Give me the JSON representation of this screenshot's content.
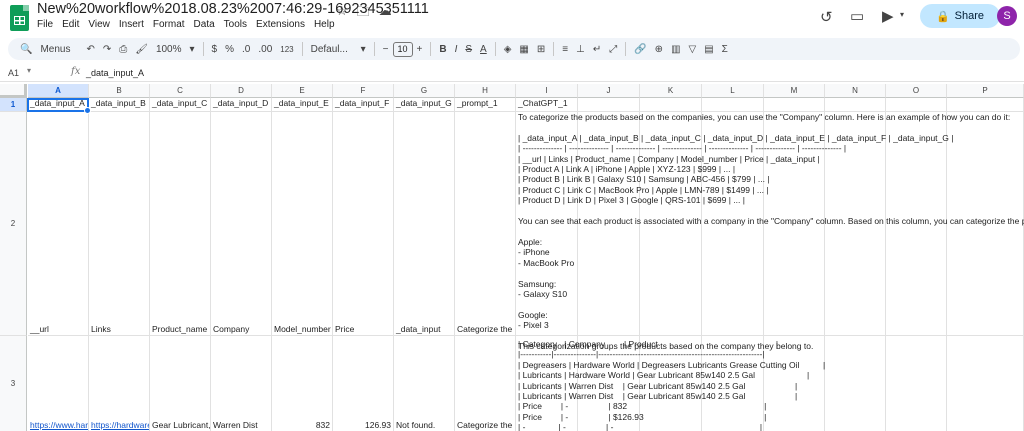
{
  "app": {
    "doc_title": "New%20workflow%2018.08.23%2007:46:29-1692345351111",
    "menus": [
      "File",
      "Edit",
      "View",
      "Insert",
      "Format",
      "Data",
      "Tools",
      "Extensions",
      "Help"
    ],
    "share_label": "Share",
    "avatar_letter": "S"
  },
  "toolbar": {
    "menus_label": "Menus",
    "zoom": "100%",
    "currency": "$",
    "percent": "%",
    "dec_decrease": ".0",
    "dec_increase": ".00",
    "format_123": "123",
    "font": "Defaul...",
    "font_size": "10",
    "bold": "B",
    "italic": "I",
    "strike": "S",
    "text_color": "A",
    "functions": "Σ"
  },
  "formula_bar": {
    "cell_ref": "A1",
    "fx": "fx",
    "content": "_data_input_A"
  },
  "columns": [
    "A",
    "B",
    "C",
    "D",
    "E",
    "F",
    "G",
    "H",
    "I",
    "J",
    "K",
    "L",
    "M",
    "N",
    "O",
    "P"
  ],
  "rows": [
    "1",
    "2",
    "3"
  ],
  "row1": [
    "_data_input_A",
    "_data_input_B",
    "_data_input_C",
    "_data_input_D",
    "_data_input_E",
    "_data_input_F",
    "_data_input_G",
    "_prompt_1",
    "_ChatGPT_1"
  ],
  "row2": [
    "__url",
    "Links",
    "Product_name",
    "Company",
    "Model_number",
    "Price",
    "_data_input",
    "Categorize the p"
  ],
  "row2_chatgpt": "To categorize the products based on the companies, you can use the \"Company\" column. Here is an example of how you can do it:\n\n| _data_input_A | _data_input_B | _data_input_C | _data_input_D | _data_input_E | _data_input_F | _data_input_G |\n| -------------- | -------------- | -------------- | -------------- | -------------- | -------------- | -------------- |\n| __url | Links | Product_name | Company | Model_number | Price | _data_input |\n| Product A | Link A | iPhone | Apple | XYZ-123 | $999 | ... |\n| Product B | Link B | Galaxy S10 | Samsung | ABC-456 | $799 | ... |\n| Product C | Link C | MacBook Pro | Apple | LMN-789 | $1499 | ... |\n| Product D | Link D | Pixel 3 | Google | QRS-101 | $699 | ... |\n\nYou can see that each product is associated with a company in the \"Company\" column. Based on this column, you can categorize the product\n\nApple:\n- iPhone\n- MacBook Pro\n\nSamsung:\n- Galaxy S10\n\nGoogle:\n- Pixel 3\n\nThis categorization groups the products based on the company they belong to.",
  "row3": [
    "https://www.hard",
    "https://hardware",
    "Gear Lubricant, I",
    "Warren Dist",
    "832",
    "126.93",
    "Not found.",
    "Categorize the p"
  ],
  "row3_chatgpt": "| Category   | Company        | Product                                                  |\n|-----------|---------------|----------------------------------------------------------|\n| Degreasers | Hardware World | Degreasers Lubricants Grease Cutting Oil          |\n| Lubricants | Hardware World | Gear Lubricant 85w140 2.5 Gal                      |\n| Lubricants | Warren Dist    | Gear Lubricant 85w140 2.5 Gal                     |\n| Lubricants | Warren Dist    | Gear Lubricant 85w140 2.5 Gal                     |\n| Price        | -                 | 832                                                          |\n| Price        | -                 | $126.93                                                   |\n| -              | -                 | -                                                              |"
}
